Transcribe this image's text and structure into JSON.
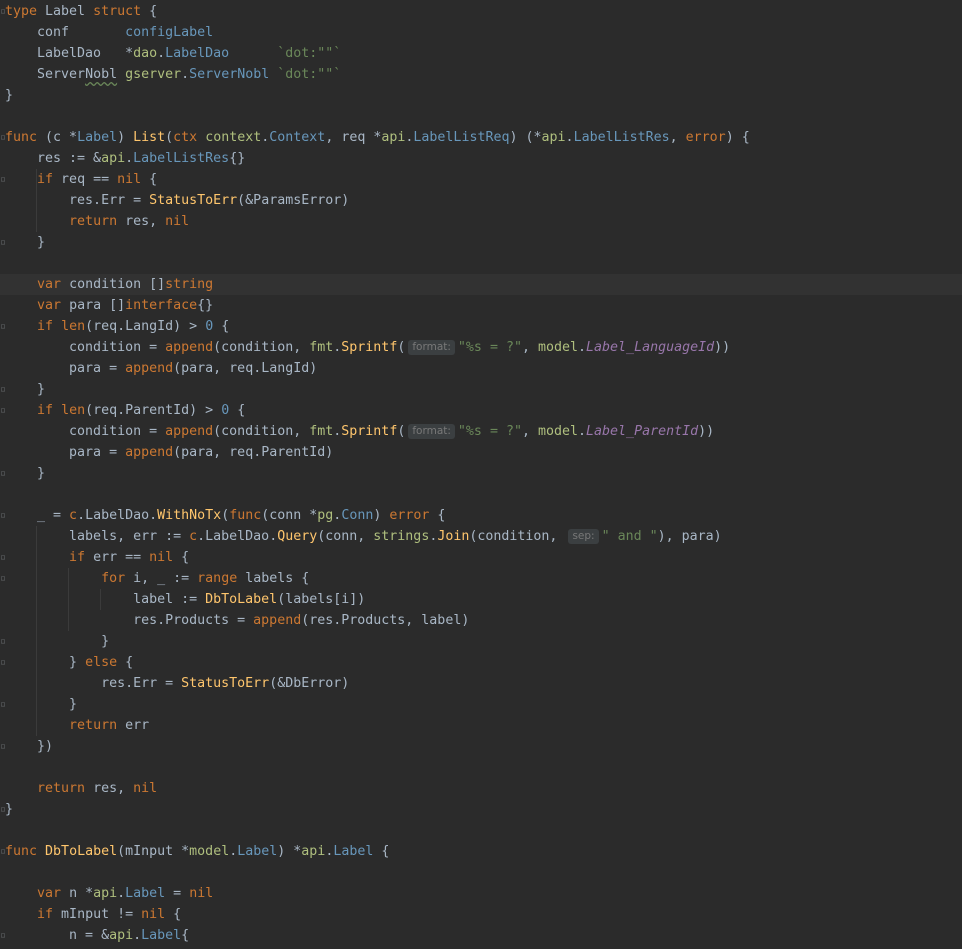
{
  "editor": {
    "language": "Go",
    "current_line_index": 13,
    "gutter_marks": [
      "fold-icon",
      "fold-icon",
      "fold-icon"
    ],
    "colors": {
      "background": "#2b2b2b",
      "keyword": "#cc7832",
      "function": "#ffc66d",
      "type": "#6897bb",
      "string": "#6a8759",
      "field": "#9876aa",
      "text": "#a9b7c6"
    },
    "inlay_hints": [
      "format:",
      "format:",
      "sep:"
    ],
    "lines": [
      [
        [
          "kw",
          "type"
        ],
        [
          "t",
          " Label "
        ],
        [
          "kw",
          "struct"
        ],
        [
          "t",
          " {"
        ]
      ],
      [
        [
          "t",
          "    conf       "
        ],
        [
          "ty",
          "configLabel"
        ]
      ],
      [
        [
          "t",
          "    LabelDao   *"
        ],
        [
          "pkg",
          "dao"
        ],
        [
          "t",
          "."
        ],
        [
          "ty",
          "LabelDao"
        ],
        [
          "t",
          "      "
        ],
        [
          "tag",
          "`dot:\"\"`"
        ]
      ],
      [
        [
          "t",
          "    ServerNobl "
        ],
        [
          "pkg",
          "gserver"
        ],
        [
          "t",
          "."
        ],
        [
          "ty",
          "ServerNobl"
        ],
        [
          "t",
          " "
        ],
        [
          "tag",
          "`dot:\"\"`"
        ]
      ],
      [
        [
          "t",
          "}"
        ]
      ],
      [
        [
          "t",
          ""
        ]
      ],
      [
        [
          "kw",
          "func"
        ],
        [
          "t",
          " (c *"
        ],
        [
          "ty",
          "Label"
        ],
        [
          "t",
          ") "
        ],
        [
          "fn",
          "List"
        ],
        [
          "t",
          "("
        ],
        [
          "kw",
          "ctx"
        ],
        [
          "t",
          " "
        ],
        [
          "pkg",
          "context"
        ],
        [
          "t",
          "."
        ],
        [
          "ty",
          "Context"
        ],
        [
          "t",
          ", req *"
        ],
        [
          "pkg",
          "api"
        ],
        [
          "t",
          "."
        ],
        [
          "ty",
          "LabelListReq"
        ],
        [
          "t",
          ") (*"
        ],
        [
          "pkg",
          "api"
        ],
        [
          "t",
          "."
        ],
        [
          "ty",
          "LabelListRes"
        ],
        [
          "t",
          ", "
        ],
        [
          "kw",
          "error"
        ],
        [
          "t",
          ") {"
        ]
      ],
      [
        [
          "t",
          "    res := &"
        ],
        [
          "pkg",
          "api"
        ],
        [
          "t",
          "."
        ],
        [
          "ty",
          "LabelListRes"
        ],
        [
          "t",
          "{}"
        ]
      ],
      [
        [
          "t",
          "    "
        ],
        [
          "kw",
          "if"
        ],
        [
          "t",
          " req == "
        ],
        [
          "kw",
          "nil"
        ],
        [
          "t",
          " {"
        ]
      ],
      [
        [
          "t",
          "        res.Err = "
        ],
        [
          "fn",
          "StatusToErr"
        ],
        [
          "t",
          "(&ParamsError)"
        ]
      ],
      [
        [
          "t",
          "        "
        ],
        [
          "kw",
          "return"
        ],
        [
          "t",
          " res, "
        ],
        [
          "kw",
          "nil"
        ]
      ],
      [
        [
          "t",
          "    }"
        ]
      ],
      [
        [
          "t",
          ""
        ]
      ],
      [
        [
          "t",
          "    "
        ],
        [
          "kw",
          "var"
        ],
        [
          "t",
          " condition []"
        ],
        [
          "kw",
          "string"
        ]
      ],
      [
        [
          "t",
          "    "
        ],
        [
          "kw",
          "var"
        ],
        [
          "t",
          " para []"
        ],
        [
          "kw",
          "interface"
        ],
        [
          "t",
          "{}"
        ]
      ],
      [
        [
          "t",
          "    "
        ],
        [
          "kw",
          "if"
        ],
        [
          "t",
          " "
        ],
        [
          "bi",
          "len"
        ],
        [
          "t",
          "(req.LangId) > "
        ],
        [
          "num",
          "0"
        ],
        [
          "t",
          " {"
        ]
      ],
      [
        [
          "t",
          "        condition = "
        ],
        [
          "bi",
          "append"
        ],
        [
          "t",
          "(condition, "
        ],
        [
          "pkg",
          "fmt"
        ],
        [
          "t",
          "."
        ],
        [
          "fn",
          "Sprintf"
        ],
        [
          "t",
          "("
        ],
        [
          "hint",
          "format:"
        ],
        [
          "str",
          "\"%s = ?\""
        ],
        [
          "t",
          ", "
        ],
        [
          "pkg",
          "model"
        ],
        [
          "t",
          "."
        ],
        [
          "field",
          "Label_LanguageId"
        ],
        [
          "t",
          "))"
        ]
      ],
      [
        [
          "t",
          "        para = "
        ],
        [
          "bi",
          "append"
        ],
        [
          "t",
          "(para, req.LangId)"
        ]
      ],
      [
        [
          "t",
          "    }"
        ]
      ],
      [
        [
          "t",
          "    "
        ],
        [
          "kw",
          "if"
        ],
        [
          "t",
          " "
        ],
        [
          "bi",
          "len"
        ],
        [
          "t",
          "(req.ParentId) > "
        ],
        [
          "num",
          "0"
        ],
        [
          "t",
          " {"
        ]
      ],
      [
        [
          "t",
          "        condition = "
        ],
        [
          "bi",
          "append"
        ],
        [
          "t",
          "(condition, "
        ],
        [
          "pkg",
          "fmt"
        ],
        [
          "t",
          "."
        ],
        [
          "fn",
          "Sprintf"
        ],
        [
          "t",
          "("
        ],
        [
          "hint",
          "format:"
        ],
        [
          "str",
          "\"%s = ?\""
        ],
        [
          "t",
          ", "
        ],
        [
          "pkg",
          "model"
        ],
        [
          "t",
          "."
        ],
        [
          "field",
          "Label_ParentId"
        ],
        [
          "t",
          "))"
        ]
      ],
      [
        [
          "t",
          "        para = "
        ],
        [
          "bi",
          "append"
        ],
        [
          "t",
          "(para, req.ParentId)"
        ]
      ],
      [
        [
          "t",
          "    }"
        ]
      ],
      [
        [
          "t",
          ""
        ]
      ],
      [
        [
          "t",
          "    _ = "
        ],
        [
          "kw",
          "c"
        ],
        [
          "t",
          "."
        ],
        [
          "t",
          "LabelDao."
        ],
        [
          "fn",
          "WithNoTx"
        ],
        [
          "t",
          "("
        ],
        [
          "kw",
          "func"
        ],
        [
          "t",
          "(conn *"
        ],
        [
          "pkg",
          "pg"
        ],
        [
          "t",
          "."
        ],
        [
          "ty",
          "Conn"
        ],
        [
          "t",
          ") "
        ],
        [
          "kw",
          "error"
        ],
        [
          "t",
          " {"
        ]
      ],
      [
        [
          "t",
          "        labels, err := "
        ],
        [
          "kw",
          "c"
        ],
        [
          "t",
          ".LabelDao."
        ],
        [
          "fn",
          "Query"
        ],
        [
          "t",
          "(conn, "
        ],
        [
          "pkg",
          "strings"
        ],
        [
          "t",
          "."
        ],
        [
          "fn",
          "Join"
        ],
        [
          "t",
          "(condition, "
        ],
        [
          "hint",
          "sep:"
        ],
        [
          "str",
          "\" and \""
        ],
        [
          "t",
          "), para)"
        ]
      ],
      [
        [
          "t",
          "        "
        ],
        [
          "kw",
          "if"
        ],
        [
          "t",
          " err == "
        ],
        [
          "kw",
          "nil"
        ],
        [
          "t",
          " {"
        ]
      ],
      [
        [
          "t",
          "            "
        ],
        [
          "kw",
          "for"
        ],
        [
          "t",
          " i, _ := "
        ],
        [
          "kw",
          "range"
        ],
        [
          "t",
          " labels {"
        ]
      ],
      [
        [
          "t",
          "                label := "
        ],
        [
          "fn",
          "DbToLabel"
        ],
        [
          "t",
          "(labels[i])"
        ]
      ],
      [
        [
          "t",
          "                res.Products = "
        ],
        [
          "bi",
          "append"
        ],
        [
          "t",
          "(res.Products, label)"
        ]
      ],
      [
        [
          "t",
          "            }"
        ]
      ],
      [
        [
          "t",
          "        } "
        ],
        [
          "kw",
          "else"
        ],
        [
          "t",
          " {"
        ]
      ],
      [
        [
          "t",
          "            res.Err = "
        ],
        [
          "fn",
          "StatusToErr"
        ],
        [
          "t",
          "(&DbError)"
        ]
      ],
      [
        [
          "t",
          "        }"
        ]
      ],
      [
        [
          "t",
          "        "
        ],
        [
          "kw",
          "return"
        ],
        [
          "t",
          " err"
        ]
      ],
      [
        [
          "t",
          "    })"
        ]
      ],
      [
        [
          "t",
          ""
        ]
      ],
      [
        [
          "t",
          "    "
        ],
        [
          "kw",
          "return"
        ],
        [
          "t",
          " res, "
        ],
        [
          "kw",
          "nil"
        ]
      ],
      [
        [
          "t",
          "}"
        ]
      ],
      [
        [
          "t",
          ""
        ]
      ],
      [
        [
          "kw",
          "func"
        ],
        [
          "t",
          " "
        ],
        [
          "fn",
          "DbToLabel"
        ],
        [
          "t",
          "(mInput *"
        ],
        [
          "pkg",
          "model"
        ],
        [
          "t",
          "."
        ],
        [
          "ty",
          "Label"
        ],
        [
          "t",
          ") *"
        ],
        [
          "pkg",
          "api"
        ],
        [
          "t",
          "."
        ],
        [
          "ty",
          "Label"
        ],
        [
          "t",
          " {"
        ]
      ],
      [
        [
          "t",
          ""
        ]
      ],
      [
        [
          "t",
          "    "
        ],
        [
          "kw",
          "var"
        ],
        [
          "t",
          " n *"
        ],
        [
          "pkg",
          "api"
        ],
        [
          "t",
          "."
        ],
        [
          "ty",
          "Label"
        ],
        [
          "t",
          " = "
        ],
        [
          "kw",
          "nil"
        ]
      ],
      [
        [
          "t",
          "    "
        ],
        [
          "kw",
          "if"
        ],
        [
          "t",
          " mInput != "
        ],
        [
          "kw",
          "nil"
        ],
        [
          "t",
          " {"
        ]
      ],
      [
        [
          "t",
          "        n = &"
        ],
        [
          "pkg",
          "api"
        ],
        [
          "t",
          "."
        ],
        [
          "ty",
          "Label"
        ],
        [
          "t",
          "{"
        ]
      ]
    ]
  }
}
